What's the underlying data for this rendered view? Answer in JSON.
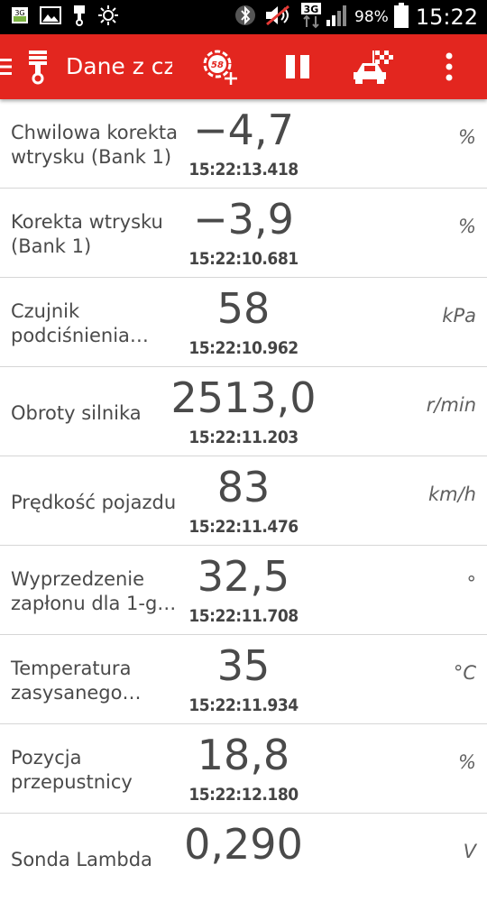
{
  "status_bar": {
    "network_type": "3G",
    "battery_percent": "98%",
    "time": "15:22",
    "icons": [
      "sim-3g-icon",
      "gallery-icon",
      "piston-icon",
      "settings-sun-icon",
      "bluetooth-icon",
      "muted-sound-icon",
      "data-3g-icon",
      "signal-icon",
      "battery-icon"
    ]
  },
  "app_bar": {
    "title": "Dane z cz",
    "icons": [
      "menu-icon",
      "piston-icon",
      "add-gauge-icon",
      "pause-icon",
      "race-car-icon",
      "overflow-menu-icon"
    ],
    "accent_color": "#e3261f"
  },
  "rows": [
    {
      "label": "Chwilowa korekta wtrysku (Bank 1)",
      "value": "−4,7",
      "time": "15:22:13.418",
      "unit": "%"
    },
    {
      "label": "Korekta wtrysku (Bank 1)",
      "value": "−3,9",
      "time": "15:22:10.681",
      "unit": "%"
    },
    {
      "label": "Czujnik podciśnienia…",
      "value": "58",
      "time": "15:22:10.962",
      "unit": "kPa"
    },
    {
      "label": "Obroty silnika",
      "value": "2513,0",
      "time": "15:22:11.203",
      "unit": "r/min"
    },
    {
      "label": "Prędkość pojazdu",
      "value": "83",
      "time": "15:22:11.476",
      "unit": "km/h"
    },
    {
      "label": "Wyprzedzenie zapłonu dla 1-g…",
      "value": "32,5",
      "time": "15:22:11.708",
      "unit": "°"
    },
    {
      "label": "Temperatura zasysanego…",
      "value": "35",
      "time": "15:22:11.934",
      "unit": "°C"
    },
    {
      "label": "Pozycja przepustnicy",
      "value": "18,8",
      "time": "15:22:12.180",
      "unit": "%"
    },
    {
      "label": "Sonda Lambda",
      "value": "0,290",
      "time": "",
      "unit": "V"
    }
  ]
}
